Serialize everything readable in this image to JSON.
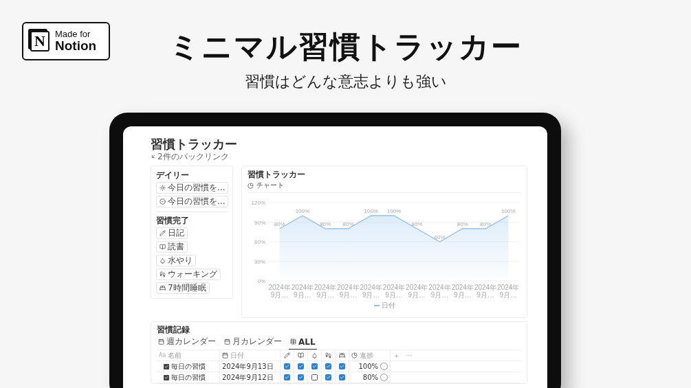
{
  "badge": {
    "line1": "Made for",
    "line2": "Notion",
    "logo": "N"
  },
  "headline": "ミニマル習慣トラッカー",
  "subtitle": "習慣はどんな意志よりも強い",
  "page": {
    "title": "習慣トラッカー",
    "backlink": "2件のバックリンク"
  },
  "daily": {
    "title": "デイリー",
    "buttons": [
      {
        "kind": "sun",
        "label": "今日の習慣を..."
      },
      {
        "kind": "check",
        "label": "今日の習慣を..."
      }
    ]
  },
  "done": {
    "title": "習慣完了",
    "buttons": [
      {
        "kind": "pencil",
        "label": "日記"
      },
      {
        "kind": "book",
        "label": "読書"
      },
      {
        "kind": "water",
        "label": "水やり"
      },
      {
        "kind": "walk",
        "label": "ウォーキング"
      },
      {
        "kind": "bed",
        "label": "7時間睡眠"
      }
    ]
  },
  "chart_panel": {
    "title": "習慣トラッカー",
    "view": "チャート",
    "chart_data": {
      "type": "area",
      "categories": [
        "2024年9月…",
        "2024年9月…",
        "2024年9月…",
        "2024年9月…",
        "2024年9月…",
        "2024年9月…",
        "2024年9月…",
        "2024年9月…",
        "2024年9月…",
        "2024年9月…",
        "2024年9月…"
      ],
      "series": [
        {
          "name": "日付",
          "color": "#8fc1ee",
          "values": [
            80,
            100,
            80,
            80,
            100,
            100,
            80,
            60,
            80,
            80,
            100
          ]
        }
      ],
      "ylim": [
        0,
        120
      ],
      "grid": true,
      "value_labels": [
        "80%",
        "100%",
        "80%",
        "80%",
        "100%",
        "100%",
        "80%",
        "60%",
        "80%",
        "80%",
        "100%"
      ],
      "yticks": [
        {
          "value": 0,
          "label": "0%"
        },
        {
          "value": 30,
          "label": "30%"
        },
        {
          "value": 60,
          "label": "60%"
        },
        {
          "value": 90,
          "label": "90%"
        },
        {
          "value": 120,
          "label": "120%"
        }
      ]
    }
  },
  "records": {
    "title": "習慣記録",
    "tabs": [
      {
        "kind": "calendar",
        "label": "週カレンダー",
        "selected": false
      },
      {
        "kind": "calendar",
        "label": "月カレンダー",
        "selected": false
      },
      {
        "kind": "table",
        "label": "ALL",
        "selected": true
      }
    ],
    "columns": [
      {
        "kind": "text",
        "prefix": "Aa",
        "label": "名前"
      },
      {
        "kind": "date",
        "label": "日付"
      },
      {
        "kind": "pencil"
      },
      {
        "kind": "book"
      },
      {
        "kind": "water"
      },
      {
        "kind": "walk"
      },
      {
        "kind": "bed"
      },
      {
        "kind": "progress",
        "label": "進捗"
      }
    ],
    "add": "+",
    "more": "···",
    "rows": [
      {
        "name": "毎日の習慣",
        "date": "2024年9月13日",
        "checks": [
          true,
          true,
          true,
          true,
          true
        ],
        "progress": "100%"
      },
      {
        "name": "毎日の習慣",
        "date": "2024年9月12日",
        "checks": [
          true,
          true,
          false,
          true,
          true
        ],
        "progress": "80%"
      }
    ]
  }
}
